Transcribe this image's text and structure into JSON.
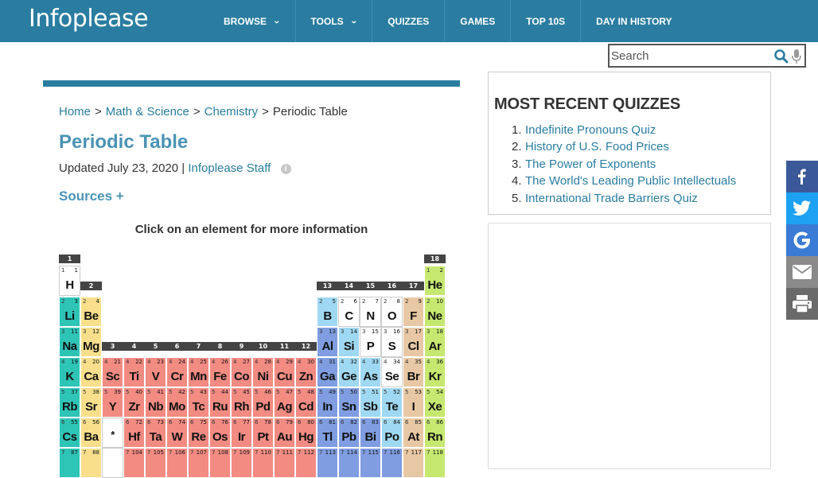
{
  "header": {
    "logo": "Infoplease",
    "nav": [
      {
        "label": "BROWSE",
        "dropdown": true
      },
      {
        "label": "TOOLS",
        "dropdown": true
      },
      {
        "label": "QUIZZES",
        "dropdown": false
      },
      {
        "label": "GAMES",
        "dropdown": false
      },
      {
        "label": "TOP 10S",
        "dropdown": false
      },
      {
        "label": "DAY IN HISTORY",
        "dropdown": false
      }
    ]
  },
  "search": {
    "placeholder": "Search",
    "value": ""
  },
  "breadcrumb": {
    "home": "Home",
    "section": "Math & Science",
    "category": "Chemistry",
    "current": "Periodic Table",
    "separator": ">"
  },
  "article": {
    "title": "Periodic Table",
    "updated_prefix": "Updated July 23, 2020 |",
    "author": "Infoplease Staff",
    "info_icon": "i",
    "sources": "Sources +",
    "hint": "Click on an element for more information"
  },
  "periodic_table": {
    "groups": [
      "1",
      "2",
      "3",
      "4",
      "5",
      "6",
      "7",
      "8",
      "9",
      "10",
      "11",
      "12",
      "13",
      "14",
      "15",
      "16",
      "17",
      "18"
    ],
    "colors": {
      "alkali": "#2ec4b6",
      "alkaline": "#f9df8c",
      "transition": "#f28b82",
      "posttransition": "#7f9de0",
      "metalloid": "#9fd8f2",
      "nonmetal": "#ffffff",
      "halogen": "#e8c8a4",
      "noble": "#c6e870",
      "placeholder": "#ffffff"
    },
    "elements": [
      {
        "s": "H",
        "n": "1",
        "p": "1",
        "g": 1,
        "r": 1,
        "c": "nonmetal"
      },
      {
        "s": "He",
        "n": "2",
        "p": "1",
        "g": 18,
        "r": 1,
        "c": "noble"
      },
      {
        "s": "Li",
        "n": "3",
        "p": "2",
        "g": 1,
        "r": 2,
        "c": "alkali"
      },
      {
        "s": "Be",
        "n": "4",
        "p": "2",
        "g": 2,
        "r": 2,
        "c": "alkaline"
      },
      {
        "s": "B",
        "n": "5",
        "p": "2",
        "g": 13,
        "r": 2,
        "c": "metalloid"
      },
      {
        "s": "C",
        "n": "6",
        "p": "2",
        "g": 14,
        "r": 2,
        "c": "nonmetal"
      },
      {
        "s": "N",
        "n": "7",
        "p": "2",
        "g": 15,
        "r": 2,
        "c": "nonmetal"
      },
      {
        "s": "O",
        "n": "8",
        "p": "2",
        "g": 16,
        "r": 2,
        "c": "nonmetal"
      },
      {
        "s": "F",
        "n": "9",
        "p": "2",
        "g": 17,
        "r": 2,
        "c": "halogen"
      },
      {
        "s": "Ne",
        "n": "10",
        "p": "2",
        "g": 18,
        "r": 2,
        "c": "noble"
      },
      {
        "s": "Na",
        "n": "11",
        "p": "3",
        "g": 1,
        "r": 3,
        "c": "alkali"
      },
      {
        "s": "Mg",
        "n": "12",
        "p": "3",
        "g": 2,
        "r": 3,
        "c": "alkaline"
      },
      {
        "s": "Al",
        "n": "13",
        "p": "3",
        "g": 13,
        "r": 3,
        "c": "posttransition"
      },
      {
        "s": "Si",
        "n": "14",
        "p": "3",
        "g": 14,
        "r": 3,
        "c": "metalloid"
      },
      {
        "s": "P",
        "n": "15",
        "p": "3",
        "g": 15,
        "r": 3,
        "c": "nonmetal"
      },
      {
        "s": "S",
        "n": "16",
        "p": "3",
        "g": 16,
        "r": 3,
        "c": "nonmetal"
      },
      {
        "s": "Cl",
        "n": "17",
        "p": "3",
        "g": 17,
        "r": 3,
        "c": "halogen"
      },
      {
        "s": "Ar",
        "n": "18",
        "p": "3",
        "g": 18,
        "r": 3,
        "c": "noble"
      },
      {
        "s": "K",
        "n": "19",
        "p": "4",
        "g": 1,
        "r": 4,
        "c": "alkali"
      },
      {
        "s": "Ca",
        "n": "20",
        "p": "4",
        "g": 2,
        "r": 4,
        "c": "alkaline"
      },
      {
        "s": "Sc",
        "n": "21",
        "p": "4",
        "g": 3,
        "r": 4,
        "c": "transition"
      },
      {
        "s": "Ti",
        "n": "22",
        "p": "4",
        "g": 4,
        "r": 4,
        "c": "transition"
      },
      {
        "s": "V",
        "n": "23",
        "p": "4",
        "g": 5,
        "r": 4,
        "c": "transition"
      },
      {
        "s": "Cr",
        "n": "24",
        "p": "4",
        "g": 6,
        "r": 4,
        "c": "transition"
      },
      {
        "s": "Mn",
        "n": "25",
        "p": "4",
        "g": 7,
        "r": 4,
        "c": "transition"
      },
      {
        "s": "Fe",
        "n": "26",
        "p": "4",
        "g": 8,
        "r": 4,
        "c": "transition"
      },
      {
        "s": "Co",
        "n": "27",
        "p": "4",
        "g": 9,
        "r": 4,
        "c": "transition"
      },
      {
        "s": "Ni",
        "n": "28",
        "p": "4",
        "g": 10,
        "r": 4,
        "c": "transition"
      },
      {
        "s": "Cu",
        "n": "29",
        "p": "4",
        "g": 11,
        "r": 4,
        "c": "transition"
      },
      {
        "s": "Zn",
        "n": "30",
        "p": "4",
        "g": 12,
        "r": 4,
        "c": "transition"
      },
      {
        "s": "Ga",
        "n": "31",
        "p": "4",
        "g": 13,
        "r": 4,
        "c": "posttransition"
      },
      {
        "s": "Ge",
        "n": "32",
        "p": "4",
        "g": 14,
        "r": 4,
        "c": "metalloid"
      },
      {
        "s": "As",
        "n": "33",
        "p": "4",
        "g": 15,
        "r": 4,
        "c": "metalloid"
      },
      {
        "s": "Se",
        "n": "34",
        "p": "4",
        "g": 16,
        "r": 4,
        "c": "nonmetal"
      },
      {
        "s": "Br",
        "n": "35",
        "p": "4",
        "g": 17,
        "r": 4,
        "c": "halogen"
      },
      {
        "s": "Kr",
        "n": "36",
        "p": "4",
        "g": 18,
        "r": 4,
        "c": "noble"
      },
      {
        "s": "Rb",
        "n": "37",
        "p": "5",
        "g": 1,
        "r": 5,
        "c": "alkali"
      },
      {
        "s": "Sr",
        "n": "38",
        "p": "5",
        "g": 2,
        "r": 5,
        "c": "alkaline"
      },
      {
        "s": "Y",
        "n": "39",
        "p": "5",
        "g": 3,
        "r": 5,
        "c": "transition"
      },
      {
        "s": "Zr",
        "n": "40",
        "p": "5",
        "g": 4,
        "r": 5,
        "c": "transition"
      },
      {
        "s": "Nb",
        "n": "41",
        "p": "5",
        "g": 5,
        "r": 5,
        "c": "transition"
      },
      {
        "s": "Mo",
        "n": "42",
        "p": "5",
        "g": 6,
        "r": 5,
        "c": "transition"
      },
      {
        "s": "Tc",
        "n": "43",
        "p": "5",
        "g": 7,
        "r": 5,
        "c": "transition"
      },
      {
        "s": "Ru",
        "n": "44",
        "p": "5",
        "g": 8,
        "r": 5,
        "c": "transition"
      },
      {
        "s": "Rh",
        "n": "45",
        "p": "5",
        "g": 9,
        "r": 5,
        "c": "transition"
      },
      {
        "s": "Pd",
        "n": "46",
        "p": "5",
        "g": 10,
        "r": 5,
        "c": "transition"
      },
      {
        "s": "Ag",
        "n": "47",
        "p": "5",
        "g": 11,
        "r": 5,
        "c": "transition"
      },
      {
        "s": "Cd",
        "n": "48",
        "p": "5",
        "g": 12,
        "r": 5,
        "c": "transition"
      },
      {
        "s": "In",
        "n": "49",
        "p": "5",
        "g": 13,
        "r": 5,
        "c": "posttransition"
      },
      {
        "s": "Sn",
        "n": "50",
        "p": "5",
        "g": 14,
        "r": 5,
        "c": "posttransition"
      },
      {
        "s": "Sb",
        "n": "51",
        "p": "5",
        "g": 15,
        "r": 5,
        "c": "metalloid"
      },
      {
        "s": "Te",
        "n": "52",
        "p": "5",
        "g": 16,
        "r": 5,
        "c": "metalloid"
      },
      {
        "s": "I",
        "n": "53",
        "p": "5",
        "g": 17,
        "r": 5,
        "c": "halogen"
      },
      {
        "s": "Xe",
        "n": "54",
        "p": "5",
        "g": 18,
        "r": 5,
        "c": "noble"
      },
      {
        "s": "Cs",
        "n": "55",
        "p": "6",
        "g": 1,
        "r": 6,
        "c": "alkali"
      },
      {
        "s": "Ba",
        "n": "56",
        "p": "6",
        "g": 2,
        "r": 6,
        "c": "alkaline"
      },
      {
        "s": "*",
        "n": "",
        "p": "",
        "g": 3,
        "r": 6,
        "c": "placeholder"
      },
      {
        "s": "Hf",
        "n": "72",
        "p": "6",
        "g": 4,
        "r": 6,
        "c": "transition"
      },
      {
        "s": "Ta",
        "n": "73",
        "p": "6",
        "g": 5,
        "r": 6,
        "c": "transition"
      },
      {
        "s": "W",
        "n": "74",
        "p": "6",
        "g": 6,
        "r": 6,
        "c": "transition"
      },
      {
        "s": "Re",
        "n": "75",
        "p": "6",
        "g": 7,
        "r": 6,
        "c": "transition"
      },
      {
        "s": "Os",
        "n": "76",
        "p": "6",
        "g": 8,
        "r": 6,
        "c": "transition"
      },
      {
        "s": "Ir",
        "n": "77",
        "p": "6",
        "g": 9,
        "r": 6,
        "c": "transition"
      },
      {
        "s": "Pt",
        "n": "78",
        "p": "6",
        "g": 10,
        "r": 6,
        "c": "transition"
      },
      {
        "s": "Au",
        "n": "79",
        "p": "6",
        "g": 11,
        "r": 6,
        "c": "transition"
      },
      {
        "s": "Hg",
        "n": "80",
        "p": "6",
        "g": 12,
        "r": 6,
        "c": "transition"
      },
      {
        "s": "Tl",
        "n": "81",
        "p": "6",
        "g": 13,
        "r": 6,
        "c": "posttransition"
      },
      {
        "s": "Pb",
        "n": "82",
        "p": "6",
        "g": 14,
        "r": 6,
        "c": "posttransition"
      },
      {
        "s": "Bi",
        "n": "83",
        "p": "6",
        "g": 15,
        "r": 6,
        "c": "posttransition"
      },
      {
        "s": "Po",
        "n": "84",
        "p": "6",
        "g": 16,
        "r": 6,
        "c": "metalloid"
      },
      {
        "s": "At",
        "n": "85",
        "p": "6",
        "g": 17,
        "r": 6,
        "c": "halogen"
      },
      {
        "s": "Rn",
        "n": "86",
        "p": "6",
        "g": 18,
        "r": 6,
        "c": "noble"
      },
      {
        "s": "",
        "n": "87",
        "p": "7",
        "g": 1,
        "r": 7,
        "c": "alkali"
      },
      {
        "s": "",
        "n": "88",
        "p": "7",
        "g": 2,
        "r": 7,
        "c": "alkaline"
      },
      {
        "s": "",
        "n": "",
        "p": "",
        "g": 3,
        "r": 7,
        "c": "placeholder"
      },
      {
        "s": "",
        "n": "104",
        "p": "7",
        "g": 4,
        "r": 7,
        "c": "transition"
      },
      {
        "s": "",
        "n": "105",
        "p": "7",
        "g": 5,
        "r": 7,
        "c": "transition"
      },
      {
        "s": "",
        "n": "106",
        "p": "7",
        "g": 6,
        "r": 7,
        "c": "transition"
      },
      {
        "s": "",
        "n": "107",
        "p": "7",
        "g": 7,
        "r": 7,
        "c": "transition"
      },
      {
        "s": "",
        "n": "108",
        "p": "7",
        "g": 8,
        "r": 7,
        "c": "transition"
      },
      {
        "s": "",
        "n": "109",
        "p": "7",
        "g": 9,
        "r": 7,
        "c": "transition"
      },
      {
        "s": "",
        "n": "110",
        "p": "7",
        "g": 10,
        "r": 7,
        "c": "transition"
      },
      {
        "s": "",
        "n": "111",
        "p": "7",
        "g": 11,
        "r": 7,
        "c": "transition"
      },
      {
        "s": "",
        "n": "112",
        "p": "7",
        "g": 12,
        "r": 7,
        "c": "transition"
      },
      {
        "s": "",
        "n": "113",
        "p": "7",
        "g": 13,
        "r": 7,
        "c": "posttransition"
      },
      {
        "s": "",
        "n": "114",
        "p": "7",
        "g": 14,
        "r": 7,
        "c": "posttransition"
      },
      {
        "s": "",
        "n": "115",
        "p": "7",
        "g": 15,
        "r": 7,
        "c": "posttransition"
      },
      {
        "s": "",
        "n": "116",
        "p": "7",
        "g": 16,
        "r": 7,
        "c": "posttransition"
      },
      {
        "s": "",
        "n": "117",
        "p": "7",
        "g": 17,
        "r": 7,
        "c": "halogen"
      },
      {
        "s": "",
        "n": "118",
        "p": "7",
        "g": 18,
        "r": 7,
        "c": "noble"
      }
    ]
  },
  "sidebar": {
    "quiz_heading": "MOST RECENT QUIZZES",
    "quizzes": [
      {
        "num": "1.",
        "title": "Indefinite Pronouns Quiz"
      },
      {
        "num": "2.",
        "title": "History of U.S. Food Prices"
      },
      {
        "num": "3.",
        "title": "The Power of Exponents"
      },
      {
        "num": "4.",
        "title": "The World's Leading Public Intellectuals"
      },
      {
        "num": "5.",
        "title": "International Trade Barriers Quiz"
      }
    ]
  },
  "share": [
    {
      "icon": "facebook-icon",
      "color": "#3b5998"
    },
    {
      "icon": "twitter-icon",
      "color": "#1da1f2"
    },
    {
      "icon": "google-icon",
      "color": "#3a7bd5"
    },
    {
      "icon": "email-icon",
      "color": "#8a8a8a"
    },
    {
      "icon": "print-icon",
      "color": "#6a6a6a"
    }
  ]
}
